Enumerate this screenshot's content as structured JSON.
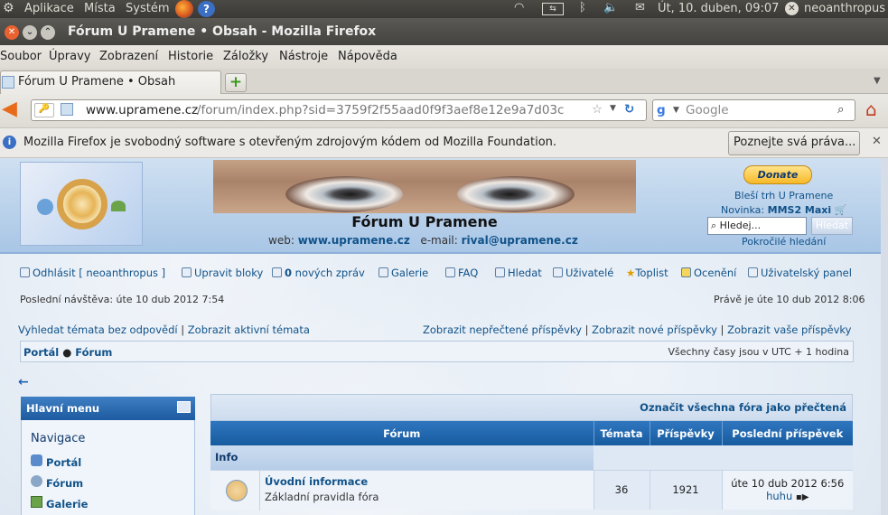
{
  "system_panel": {
    "apps": "Aplikace",
    "places": "Místa",
    "system": "Systém",
    "datetime": "Út, 10. duben, 09:07",
    "username": "neoanthropus"
  },
  "window": {
    "title": "Fórum U Pramene • Obsah - Mozilla Firefox"
  },
  "menubar": {
    "items": [
      "Soubor",
      "Úpravy",
      "Zobrazení",
      "Historie",
      "Záložky",
      "Nástroje",
      "Nápověda"
    ]
  },
  "tabs": {
    "active": "Fórum U Pramene • Obsah"
  },
  "navigation": {
    "url_domain": "www.upramene.cz",
    "url_path": "/forum/index.php?sid=3759f2f55aad0f9f3aef8e12e9a7d03c",
    "search_placeholder": "Google"
  },
  "notification": {
    "message": "Mozilla Firefox je svobodný software s otevřeným zdrojovým kódem od Mozilla Foundation.",
    "button": "Poznejte svá práva..."
  },
  "site": {
    "title": "Fórum U Pramene",
    "web_label": "web:",
    "web_value": "www.upramene.cz",
    "email_label": "e-mail:",
    "email_value": "rival@upramene.cz",
    "donate": "Donate",
    "promo1": "Bleší trh U Pramene",
    "promo2_label": "Novinka:",
    "promo2_value": "MMS2 Maxi",
    "search_value": "Hledej...",
    "search_button": "Hledat",
    "advanced_search": "Pokročilé hledání"
  },
  "user_nav": {
    "logout": "Odhlásit [ neoanthropus ]",
    "edit_blocks": "Upravit bloky",
    "new_messages_count": "0",
    "new_messages_label": "nových zpráv",
    "gallery": "Galerie",
    "faq": "FAQ",
    "search": "Hledat",
    "users": "Uživatelé",
    "toplist": "Toplist",
    "ratings": "Ocenění",
    "user_panel": "Uživatelský panel"
  },
  "visit_info": {
    "last_visit": "Poslední návštěva: úte 10 dub 2012 7:54",
    "now": "Právě je úte 10 dub 2012 8:06"
  },
  "quick_links": {
    "unanswered": "Vyhledat témata bez odpovědí",
    "active": "Zobrazit aktivní témata",
    "unread": "Zobrazit nepřečtené příspěvky",
    "new": "Zobrazit nové příspěvky",
    "yours": "Zobrazit vaše příspěvky"
  },
  "breadcrumb": {
    "portal": "Portál",
    "forum": "Fórum",
    "timezone": "Všechny časy jsou v UTC + 1 hodina"
  },
  "sidebar": {
    "title": "Hlavní menu",
    "section": "Navigace",
    "items": [
      "Portál",
      "Fórum",
      "Galerie"
    ]
  },
  "forum_table": {
    "mark_read": "Označit všechna fóra jako přečtená",
    "headers": [
      "Fórum",
      "Témata",
      "Příspěvky",
      "Poslední příspěvek"
    ],
    "category": "Info",
    "rows": [
      {
        "name": "Úvodní informace",
        "description": "Základní pravidla fóra",
        "topics": "36",
        "posts": "1921",
        "last_post_date": "úte 10 dub 2012 6:56",
        "last_post_user": "huhu"
      }
    ]
  },
  "colors": {
    "link": "#105289",
    "header_blue": "#1d5aa0",
    "panel_dark": "#3a3935"
  }
}
